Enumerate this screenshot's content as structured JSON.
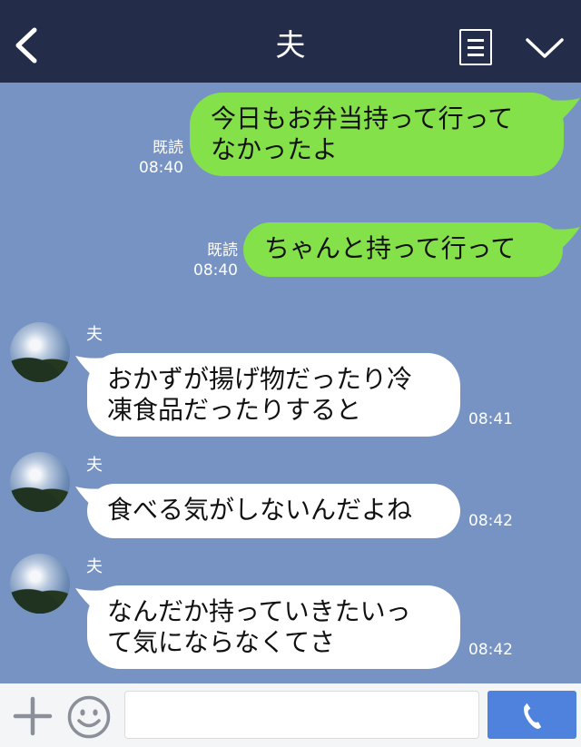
{
  "header": {
    "title": "夫"
  },
  "messages": [
    {
      "type": "out",
      "text_lines": [
        "今日もお弁当持って行って",
        "なかったよ"
      ],
      "read": "既読",
      "time": "08:40"
    },
    {
      "type": "out",
      "text_lines": [
        "ちゃんと持って行って"
      ],
      "read": "既読",
      "time": "08:40"
    },
    {
      "type": "in",
      "name": "夫",
      "text_lines": [
        "おかずが揚げ物だったり冷",
        "凍食品だったりすると"
      ],
      "time": "08:41"
    },
    {
      "type": "in",
      "name": "夫",
      "text_lines": [
        "食べる気がしないんだよね"
      ],
      "time": "08:42"
    },
    {
      "type": "in",
      "name": "夫",
      "text_lines": [
        "なんだか持っていきたいっ",
        "て気にならなくてさ"
      ],
      "time": "08:42"
    }
  ],
  "input": {
    "value": "",
    "placeholder": ""
  },
  "icons": {
    "back": "chevron-left-icon",
    "menu": "document-menu-icon",
    "collapse": "chevron-down-icon",
    "add": "plus-icon",
    "emoji": "smiley-icon",
    "call": "phone-icon"
  },
  "colors": {
    "header_bg": "#232d4a",
    "chat_bg": "#7693c4",
    "outgoing_bubble": "#85e14a",
    "incoming_bubble": "#ffffff",
    "call_button": "#4f82dc"
  }
}
